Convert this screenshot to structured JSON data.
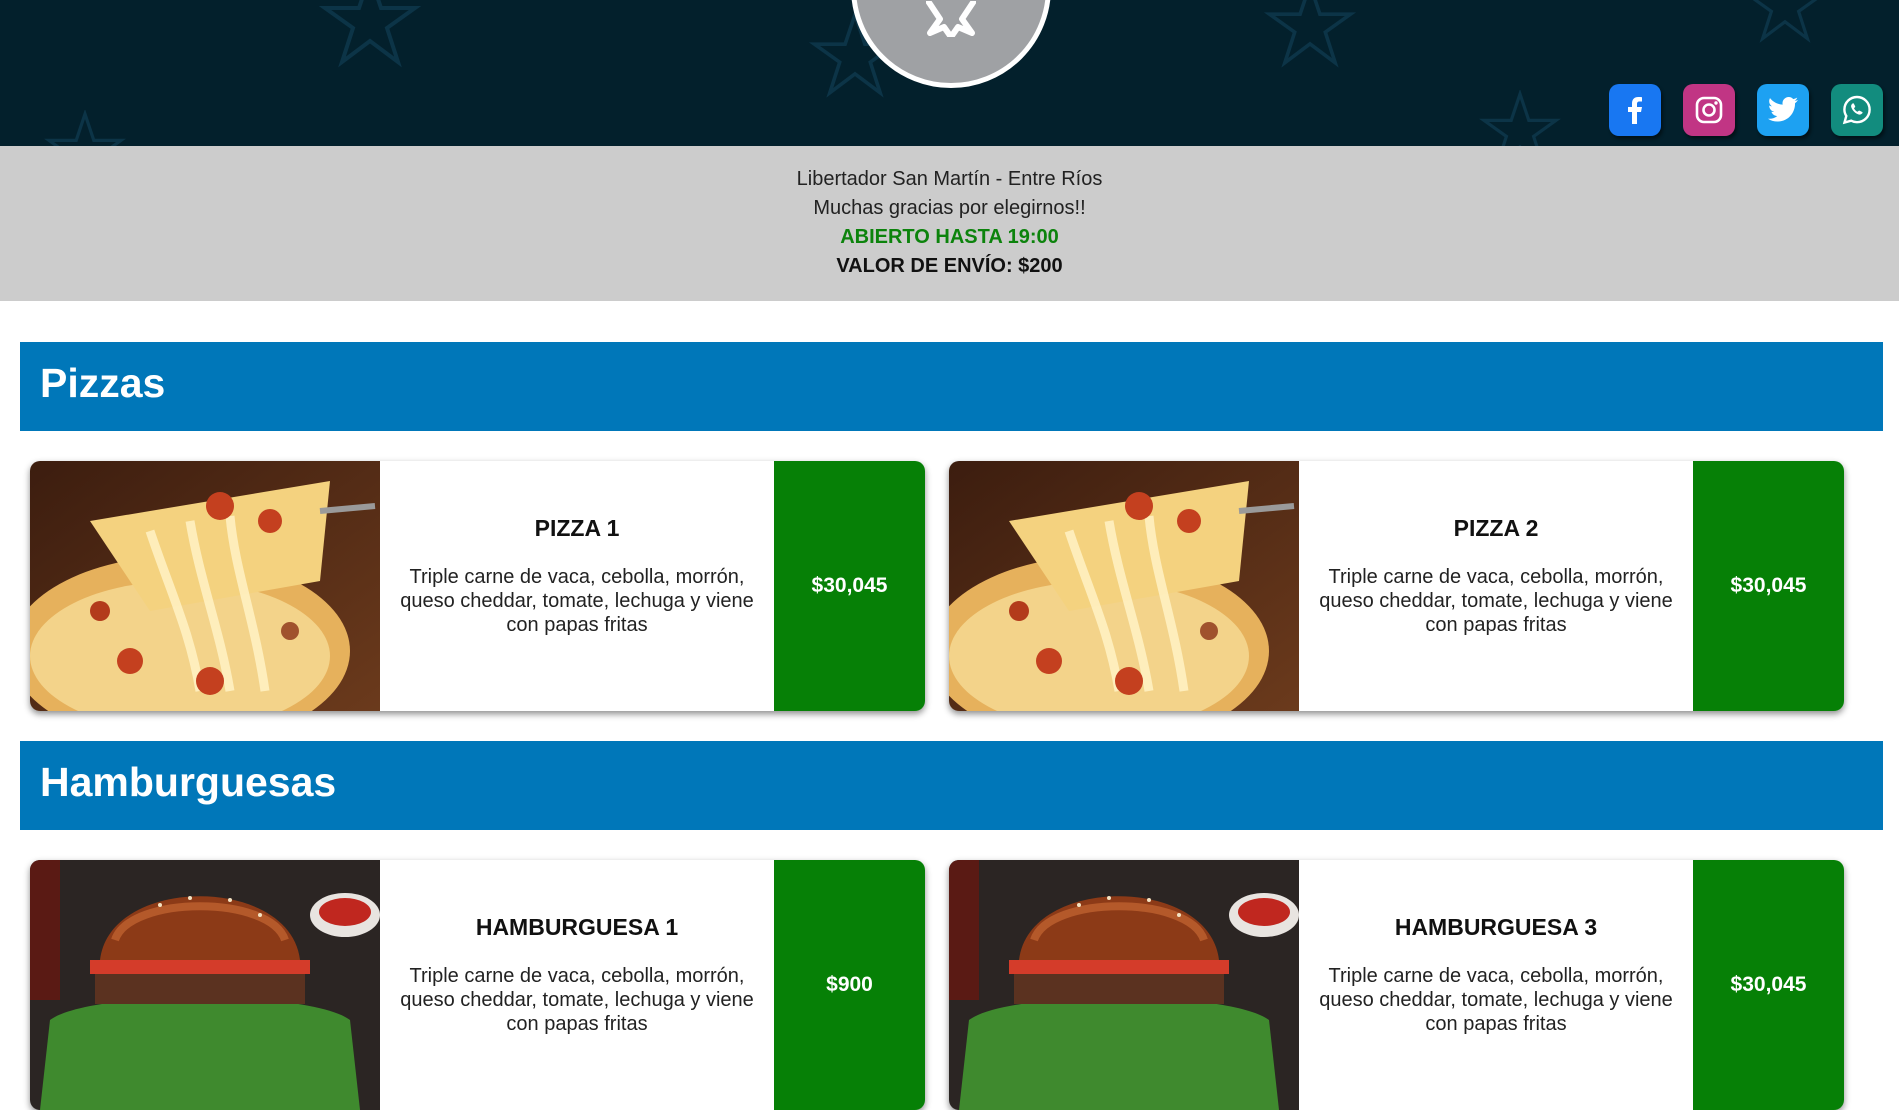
{
  "header": {
    "logo_icon": "star-icon",
    "social": [
      {
        "name": "facebook",
        "icon": "facebook-icon",
        "color": "#1877f2"
      },
      {
        "name": "instagram",
        "icon": "instagram-icon",
        "color": "#c13584"
      },
      {
        "name": "twitter",
        "icon": "twitter-icon",
        "color": "#1da1f2"
      },
      {
        "name": "whatsapp",
        "icon": "whatsapp-icon",
        "color": "#128c7e"
      }
    ]
  },
  "info": {
    "location": "Libertador San Martín - Entre Ríos",
    "thanks": "Muchas gracias por elegirnos!!",
    "hours": "ABIERTO HASTA 19:00",
    "shipping": "VALOR DE ENVÍO: $200"
  },
  "sections": [
    {
      "title": "Pizzas",
      "items": [
        {
          "name": "PIZZA 1",
          "description": "Triple carne de vaca, cebolla, morrón, queso cheddar, tomate, lechuga y viene con papas fritas",
          "price": "$30,045"
        },
        {
          "name": "PIZZA 2",
          "description": "Triple carne de vaca, cebolla, morrón, queso cheddar, tomate, lechuga y viene con papas fritas",
          "price": "$30,045"
        }
      ]
    },
    {
      "title": "Hamburguesas",
      "items": [
        {
          "name": "HAMBURGUESA 1",
          "description": "Triple carne de vaca, cebolla, morrón, queso cheddar, tomate, lechuga y viene con papas fritas",
          "price": "$900"
        },
        {
          "name": "HAMBURGUESA 3",
          "description": "Triple carne de vaca, cebolla, morrón, queso cheddar, tomate, lechuga y viene con papas fritas",
          "price": "$30,045"
        }
      ]
    }
  ],
  "colors": {
    "header_bg": "#03202c",
    "info_bg": "#cccccc",
    "section_bg": "#0077b9",
    "price_bg": "#068006",
    "open_text": "#0c830c"
  }
}
